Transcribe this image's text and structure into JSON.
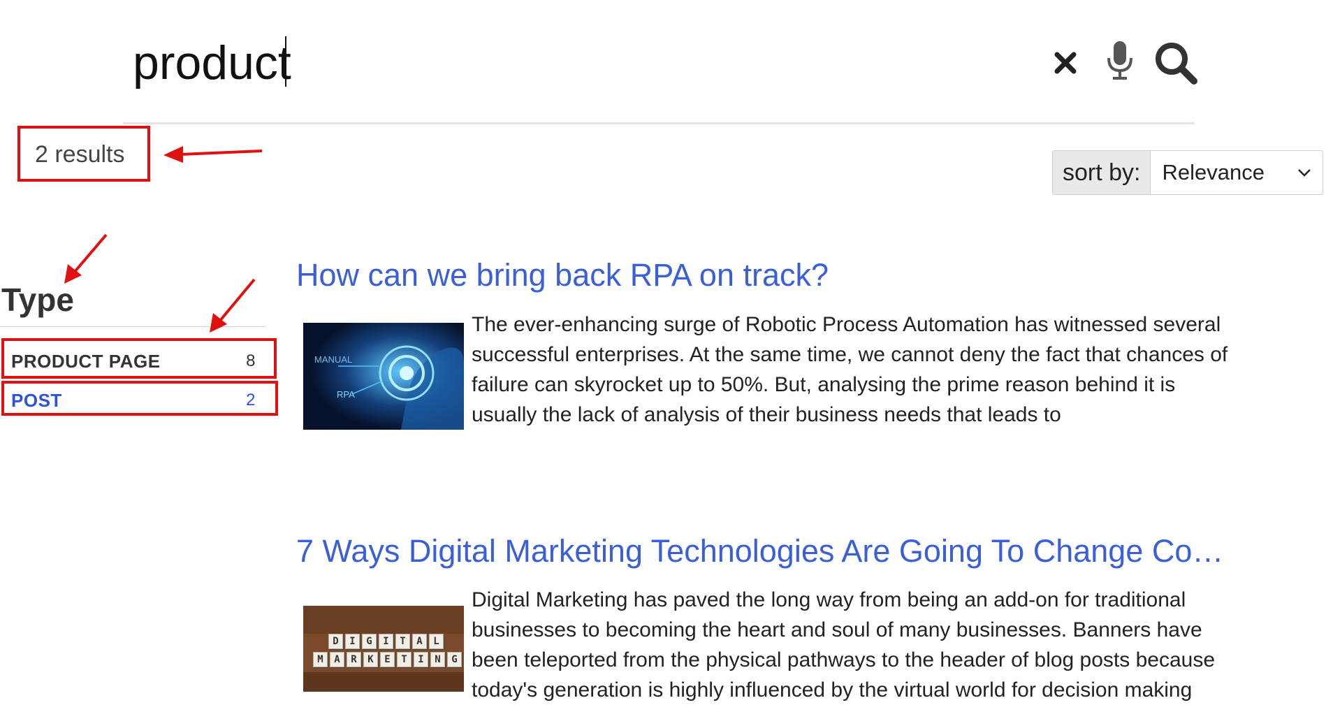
{
  "search": {
    "query": "product",
    "clear_icon": "close-icon",
    "voice_icon": "microphone-icon",
    "submit_icon": "search-icon"
  },
  "summary": {
    "results_count": "2 results"
  },
  "sort": {
    "label": "sort by:",
    "selected": "Relevance",
    "icon": "chevron-down-icon"
  },
  "facets": {
    "title": "Type",
    "items": [
      {
        "label": "PRODUCT PAGE",
        "count": "8",
        "color": "#333333"
      },
      {
        "label": "POST",
        "count": "2",
        "color": "#2c53d9"
      }
    ]
  },
  "results": [
    {
      "title": "How can we bring back RPA on track?",
      "thumb_labels": [
        "MANUAL",
        "RPA"
      ],
      "snippet": "The ever-enhancing surge of Robotic Process Automation has witnessed several successful enterprises. At the same time, we cannot deny the fact that chances of failure can skyrocket up to 50%. But, analysing the prime reason behind it is usually the lack of analysis of their business needs that leads to"
    },
    {
      "title": "7 Ways Digital Marketing Technologies Are Going To Change Cons…",
      "thumb_words": [
        "DIGITAL",
        "MARKETING"
      ],
      "snippet": "Digital Marketing has paved the long way from being an add-on for traditional businesses to becoming the heart and soul of many businesses. Banners have been teleported from the physical pathways to the header of blog posts because today's generation is highly influenced by the virtual world for decision making"
    }
  ],
  "colors": {
    "link": "#3b5fd9",
    "annotation": "#e01010"
  }
}
